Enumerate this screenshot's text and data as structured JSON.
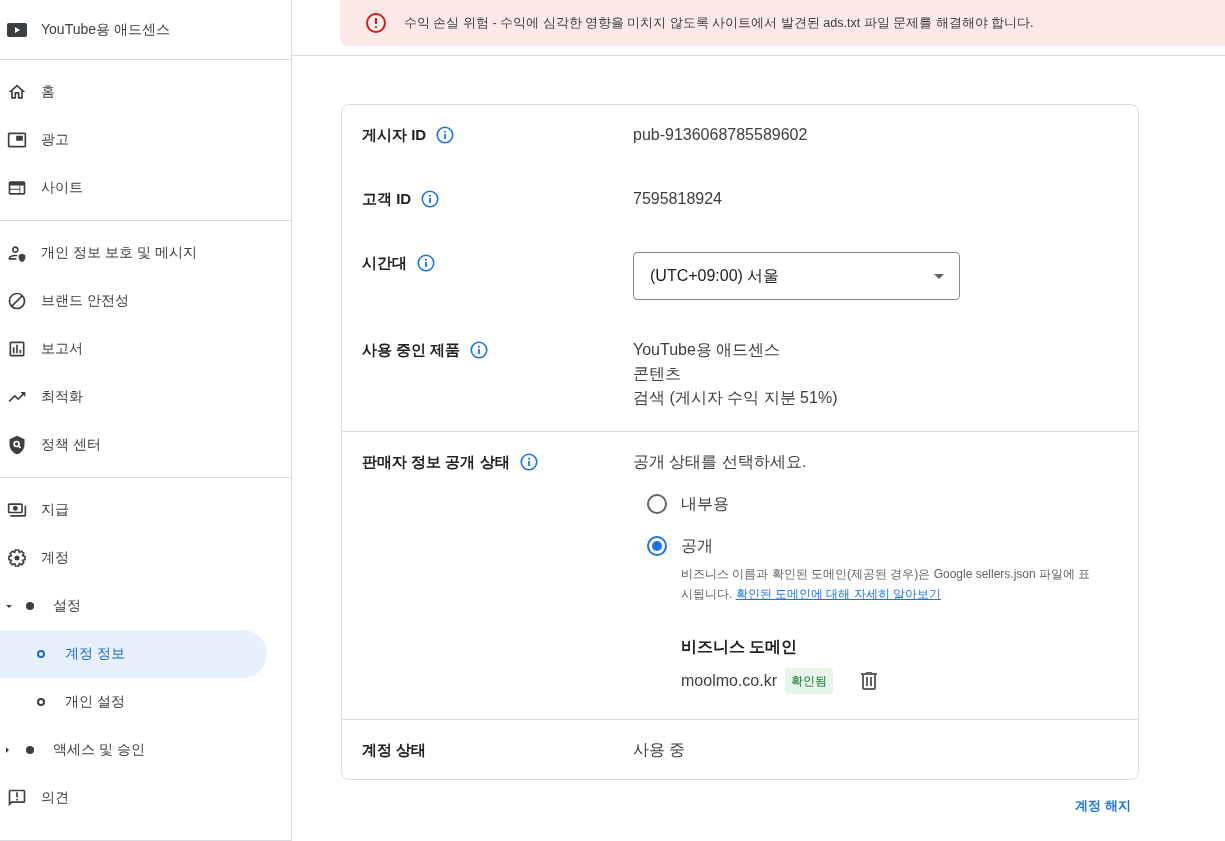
{
  "sidebar": {
    "product": "YouTube용 애드센스",
    "groups": [
      {
        "items": [
          {
            "label": "홈",
            "selected": false
          },
          {
            "label": "광고",
            "selected": false
          },
          {
            "label": "사이트",
            "selected": false
          }
        ]
      },
      {
        "items": [
          {
            "label": "개인 정보 보호 및 메시지",
            "selected": false
          },
          {
            "label": "브랜드 안전성",
            "selected": false
          },
          {
            "label": "보고서",
            "selected": false
          },
          {
            "label": "최적화",
            "selected": false
          },
          {
            "label": "정책 센터",
            "selected": false
          }
        ]
      },
      {
        "items": [
          {
            "label": "지급",
            "selected": false
          },
          {
            "label": "계정",
            "selected": false,
            "children": [
              {
                "label": "설정",
                "selected": false,
                "expanded": true,
                "children": [
                  {
                    "label": "계정 정보",
                    "selected": true
                  },
                  {
                    "label": "개인 설정",
                    "selected": false
                  }
                ]
              },
              {
                "label": "액세스 및 승인",
                "selected": false,
                "expanded": false
              }
            ]
          },
          {
            "label": "의견",
            "selected": false
          }
        ]
      }
    ]
  },
  "banner": {
    "text": "수익 손실 위험 - 수익에 심각한 영향을 미치지 않도록 사이트에서 발견된 ads.txt 파일 문제를 해결해야 합니다."
  },
  "account": {
    "sections": [
      {
        "rows": [
          {
            "kind": "text",
            "label": "게시자 ID",
            "info": true,
            "value": "pub-9136068785589602"
          },
          {
            "kind": "text",
            "label": "고객 ID",
            "info": true,
            "value": "7595818924"
          },
          {
            "kind": "select",
            "label": "시간대",
            "info": true,
            "value": "(UTC+09:00) 서울"
          },
          {
            "kind": "list",
            "label": "사용 중인 제품",
            "info": true,
            "values": [
              "YouTube용 애드센스",
              "콘텐츠",
              "검색 (게시자 수익 지분 51%)"
            ]
          }
        ]
      },
      {
        "rows": [
          {
            "kind": "radio",
            "label": "판매자 정보 공개 상태",
            "info": true,
            "prompt": "공개 상태를 선택하세요.",
            "options": [
              {
                "label": "내부용",
                "selected": false
              },
              {
                "label": "공개",
                "selected": true,
                "description": "비즈니스 이름과 확인된 도메인(제공된 경우)은 Google sellers.json 파일에 표시됩니다.",
                "link": "확인된 도메인에 대해 자세히 알아보기"
              }
            ],
            "domain": {
              "title": "비즈니스 도메인",
              "name": "moolmo.co.kr",
              "status": "확인됨"
            }
          }
        ]
      },
      {
        "rows": [
          {
            "kind": "text",
            "label": "계정 상태",
            "info": false,
            "value": "사용 중"
          }
        ]
      }
    ]
  },
  "close_account": "계정 해지"
}
